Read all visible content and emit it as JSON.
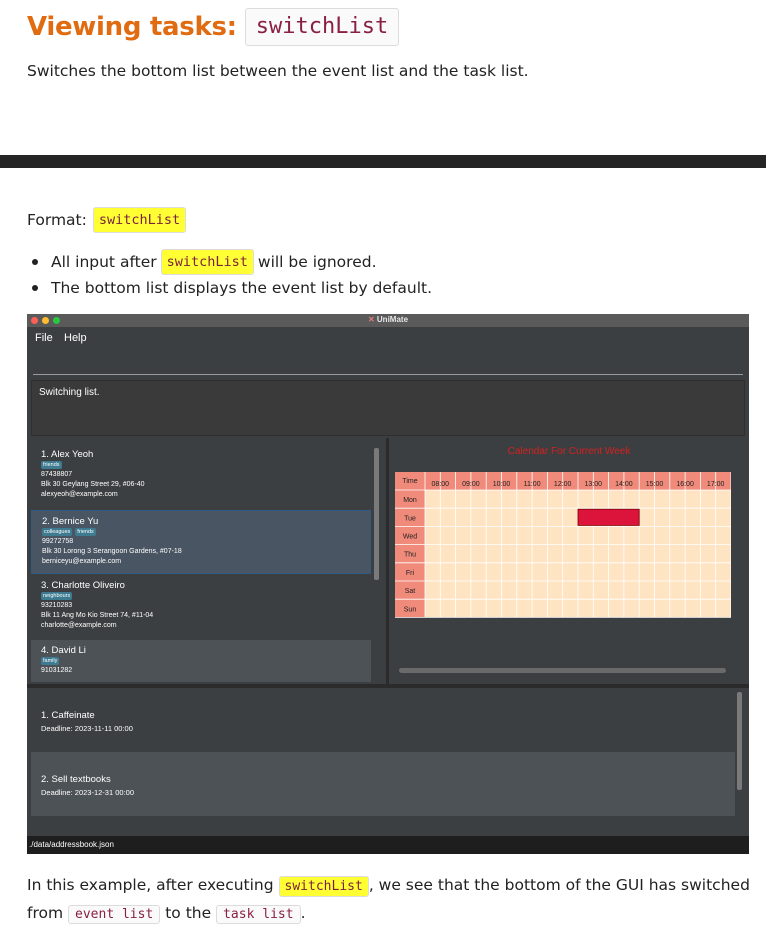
{
  "heading": {
    "title": "Viewing tasks:",
    "command": "switchList"
  },
  "description": "Switches the bottom list between the event list and the task list.",
  "format": {
    "label": "Format:",
    "command": "switchList"
  },
  "bullets": [
    {
      "before": "All input after",
      "code": "switchList",
      "after": "will be ignored."
    },
    {
      "text": "The bottom list displays the event list by default."
    }
  ],
  "app": {
    "title": "UniMate",
    "menu": [
      "File",
      "Help"
    ],
    "result_message": "Switching list.",
    "persons": [
      {
        "name": "1.  Alex Yeoh",
        "tags": [
          "friends"
        ],
        "phone": "87438807",
        "address": "Blk 30 Geylang Street 29, #06-40",
        "email": "alexyeoh@example.com"
      },
      {
        "name": "2.  Bernice Yu",
        "tags": [
          "colleagues",
          "friends"
        ],
        "phone": "99272758",
        "address": "Blk 30 Lorong 3 Serangoon Gardens, #07-18",
        "email": "berniceyu@example.com"
      },
      {
        "name": "3.  Charlotte Oliveiro",
        "tags": [
          "neighbours"
        ],
        "phone": "93210283",
        "address": "Blk 11 Ang Mo Kio Street 74, #11-04",
        "email": "charlotte@example.com"
      },
      {
        "name": "4.  David Li",
        "tags": [
          "family"
        ],
        "phone": "91031282",
        "address": "",
        "email": ""
      }
    ],
    "calendar": {
      "title": "Calendar For Current Week",
      "corner": "Time",
      "hours": [
        "08:00",
        "09:00",
        "10:00",
        "11:00",
        "12:00",
        "13:00",
        "14:00",
        "15:00",
        "16:00",
        "17:00"
      ],
      "days": [
        "Mon",
        "Tue",
        "Wed",
        "Thu",
        "Fri",
        "Sat",
        "Sun"
      ],
      "event": {
        "day": "Tue",
        "start": "13:00",
        "end": "15:00",
        "color": "#dc143c"
      },
      "colors": {
        "header": "#f08a7a",
        "cell": "#ffe4c4",
        "grid": "#ffffff"
      }
    },
    "tasks": [
      {
        "name": "1.  Caffeinate",
        "deadline": "Deadline: 2023-11-11 00:00"
      },
      {
        "name": "2.  Sell textbooks",
        "deadline": "Deadline: 2023-12-31 00:00"
      }
    ],
    "status_path": "./data/addressbook.json"
  },
  "example": {
    "text1": "In this example, after executing",
    "code1": "switchList",
    "text2": ", we see that the bottom of the GUI has switched from",
    "code2": "event list",
    "text3": "to the",
    "code3": "task list",
    "text4": "."
  },
  "colors": {
    "heading": "#e06b10",
    "highlight": "#ffff33",
    "code_text": "#8a1f45",
    "tag": "#3e7b91"
  }
}
